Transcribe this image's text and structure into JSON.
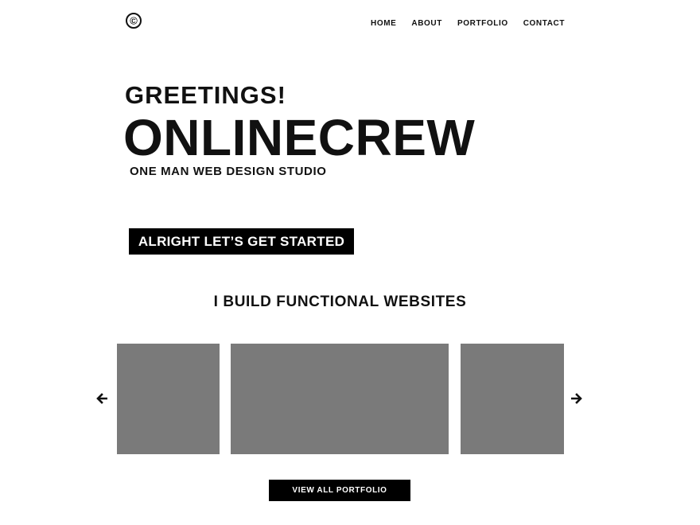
{
  "header": {
    "logo_glyph": "©",
    "nav": [
      {
        "label": "HOME"
      },
      {
        "label": "ABOUT"
      },
      {
        "label": "PORTFOLIO"
      },
      {
        "label": "CONTACT"
      }
    ]
  },
  "hero": {
    "greeting": "GREETINGS!",
    "brand": "ONLINECREW",
    "tagline": "ONE MAN WEB DESIGN STUDIO",
    "cta_label": "ALRIGHT LET’S GET STARTED"
  },
  "portfolio": {
    "heading": "I BUILD FUNCTIONAL WEBSITES",
    "slide_color": "#7a7a7a",
    "prev_icon": "arrow-left-icon",
    "next_icon": "arrow-right-icon",
    "view_all_label": "VIEW ALL PORTFOLIO"
  }
}
